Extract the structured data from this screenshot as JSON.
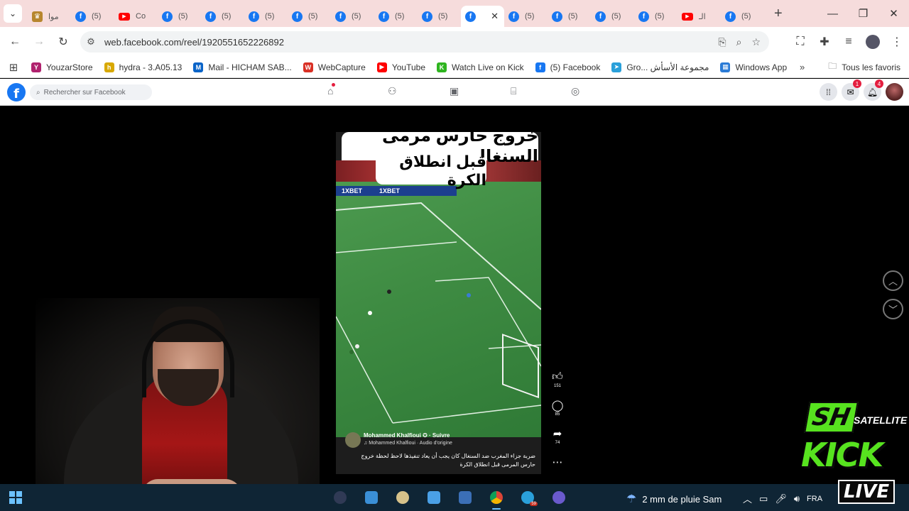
{
  "browser": {
    "tabs": [
      {
        "icon": "crest-icon",
        "label": "موا"
      },
      {
        "icon": "facebook-icon",
        "label": "(5)"
      },
      {
        "icon": "youtube-icon",
        "label": "Co"
      },
      {
        "icon": "facebook-icon",
        "label": "(5)"
      },
      {
        "icon": "facebook-icon",
        "label": "(5)"
      },
      {
        "icon": "facebook-icon",
        "label": "(5)"
      },
      {
        "icon": "facebook-icon",
        "label": "(5)"
      },
      {
        "icon": "facebook-icon",
        "label": "(5)"
      },
      {
        "icon": "facebook-icon",
        "label": "(5)"
      },
      {
        "icon": "facebook-icon",
        "label": "(5)"
      },
      {
        "icon": "facebook-icon",
        "label": "",
        "active": true
      },
      {
        "icon": "facebook-icon",
        "label": "(5)"
      },
      {
        "icon": "facebook-icon",
        "label": "(5)"
      },
      {
        "icon": "facebook-icon",
        "label": "(5)"
      },
      {
        "icon": "facebook-icon",
        "label": "(5)"
      },
      {
        "icon": "youtube-icon",
        "label": "الـ"
      },
      {
        "icon": "facebook-icon",
        "label": "(5)"
      }
    ],
    "url": "web.facebook.com/reel/1920551652226892",
    "bookmarks": [
      {
        "label": "YouzarStore",
        "color": "#b0226e",
        "glyph": "Y"
      },
      {
        "label": "hydra - 3.A05.13",
        "color": "#d8a800",
        "glyph": "h"
      },
      {
        "label": "Mail - HICHAM SAB...",
        "color": "#0a64c8",
        "glyph": "M"
      },
      {
        "label": "WebCapture",
        "color": "#d93025",
        "glyph": "W"
      },
      {
        "label": "YouTube",
        "color": "#ff0000",
        "glyph": "▶"
      },
      {
        "label": "Watch Live on Kick",
        "color": "#2fb520",
        "glyph": "K"
      },
      {
        "label": "(5) Facebook",
        "color": "#1877f2",
        "glyph": "f"
      },
      {
        "label": "Gro... مجموعة الأسأش",
        "color": "#2aa0da",
        "glyph": "➤"
      },
      {
        "label": "Windows App",
        "color": "#2b7bd6",
        "glyph": "▦"
      }
    ],
    "all_bookmarks_label": "Tous les favoris"
  },
  "facebook": {
    "search_placeholder": "Rechercher sur Facebook",
    "messenger_badge": "1",
    "notifications_badge": "4"
  },
  "reel": {
    "overlay_line1": "خروج حارس مرمى السنغال",
    "overlay_line2": "قبل انطلاق الكرة",
    "ad_text_1": "1XBET",
    "ad_text_2": "1XBET",
    "author": "Mohammed Khalfioui ✪ · Suivre",
    "audio": "♫ Mohammed Khalfioui · Audio d'origine",
    "description": "ضربة جزاء المغرب ضد السنغال كان يجب أن يعاد تنفيذها لاحظ لحظة خروج حارس المرمى قبل انطلاق الكرة",
    "likes": "151",
    "comments": "85",
    "shares": "74"
  },
  "taskbar": {
    "weather": "2 mm de pluie Sam",
    "language": "FRA",
    "telegram_badge": "59"
  },
  "overlay": {
    "brand_sh": "SH",
    "brand_sub": "SATELLITE",
    "kick": "KICK",
    "live": "LIVE"
  }
}
